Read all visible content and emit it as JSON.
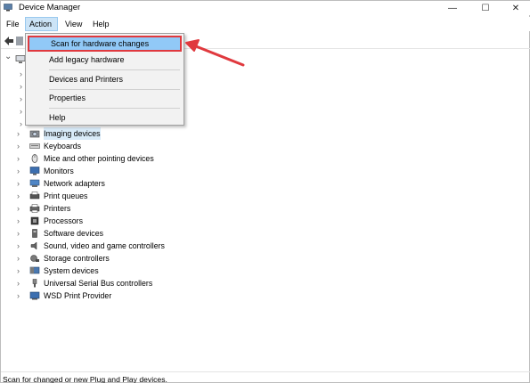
{
  "window": {
    "title": "Device Manager",
    "controls": {
      "minimize": "—",
      "maximize": "☐",
      "close": "✕"
    }
  },
  "menubar": {
    "file": "File",
    "action": "Action",
    "view": "View",
    "help": "Help"
  },
  "action_menu": {
    "items": [
      {
        "label": "Scan for hardware changes"
      },
      {
        "label": "Add legacy hardware"
      },
      {
        "label": "Devices and Printers"
      },
      {
        "label": "Properties"
      },
      {
        "label": "Help"
      }
    ]
  },
  "tree": {
    "expand_glyph": "›",
    "collapse_glyph": "⌄",
    "items": [
      {
        "label": "Imaging devices",
        "icon": "camera-icon"
      },
      {
        "label": "Keyboards",
        "icon": "keyboard-icon"
      },
      {
        "label": "Mice and other pointing devices",
        "icon": "mouse-icon"
      },
      {
        "label": "Monitors",
        "icon": "monitor-icon"
      },
      {
        "label": "Network adapters",
        "icon": "network-adapter-icon"
      },
      {
        "label": "Print queues",
        "icon": "print-queue-icon"
      },
      {
        "label": "Printers",
        "icon": "printer-icon"
      },
      {
        "label": "Processors",
        "icon": "processor-icon"
      },
      {
        "label": "Software devices",
        "icon": "software-device-icon"
      },
      {
        "label": "Sound, video and game controllers",
        "icon": "speaker-icon"
      },
      {
        "label": "Storage controllers",
        "icon": "storage-controller-icon"
      },
      {
        "label": "System devices",
        "icon": "system-device-icon"
      },
      {
        "label": "Universal Serial Bus controllers",
        "icon": "usb-icon"
      },
      {
        "label": "WSD Print Provider",
        "icon": "wsd-printer-icon"
      }
    ]
  },
  "statusbar": {
    "text": "Scan for changed or new Plug and Play devices."
  },
  "colors": {
    "menu_highlight": "#cce4f7",
    "dropdown_hover": "#91c9f7",
    "annotation_red": "#e0393e"
  }
}
